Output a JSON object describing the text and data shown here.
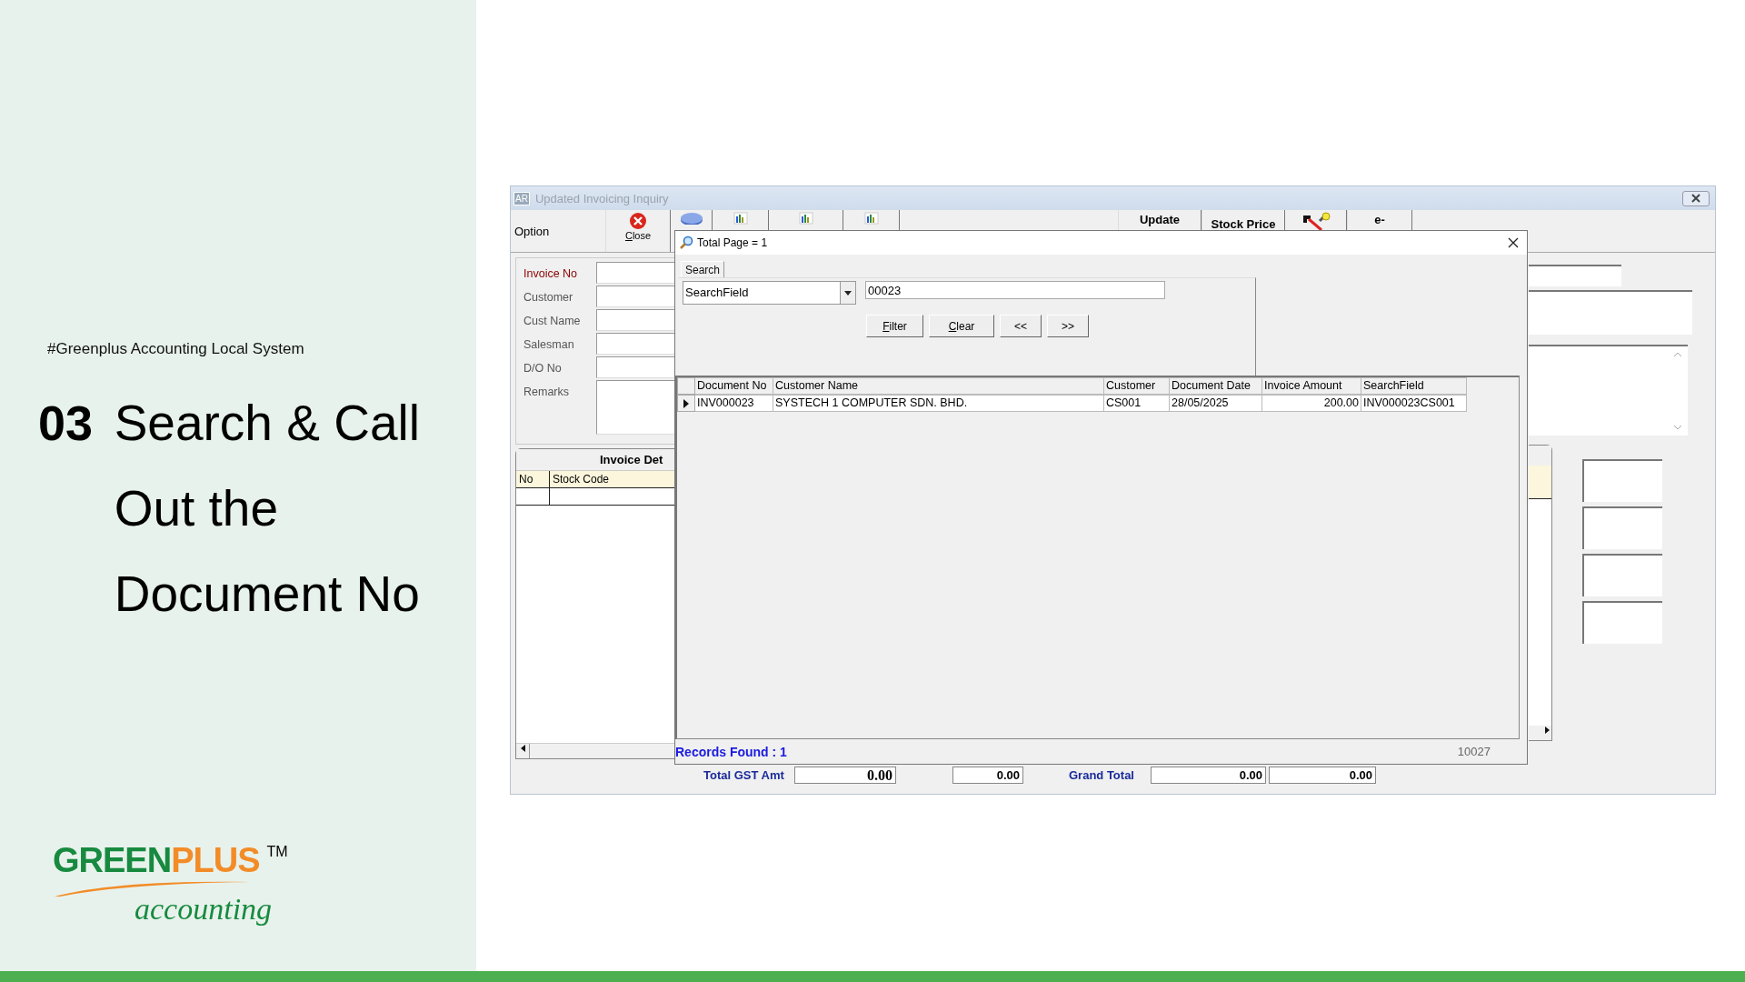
{
  "slide": {
    "hashtag": "#Greenplus Accounting Local System",
    "number": "03",
    "title": "Search & Call Out the Document No"
  },
  "logo": {
    "parts": [
      {
        "text": "GREEN",
        "color": "#178a3f"
      },
      {
        "text": "PLUS",
        "color": "#f28c28"
      }
    ],
    "trademark": "TM",
    "tagline": "accounting"
  },
  "window": {
    "badge": "AR",
    "title": "Updated Invoicing Inquiry"
  },
  "toolbar": {
    "option": "Option",
    "close": "Close",
    "update": "Update",
    "stock_price": "Stock Price",
    "e_label": "e-"
  },
  "form": {
    "fields": [
      {
        "label": "Invoice No",
        "required": true
      },
      {
        "label": "Customer",
        "required": false
      },
      {
        "label": "Cust Name",
        "required": false
      },
      {
        "label": "Salesman",
        "required": false
      },
      {
        "label": "D/O No",
        "required": false
      },
      {
        "label": "Remarks",
        "required": false
      }
    ]
  },
  "details": {
    "tab": "Invoice Det",
    "columns": [
      "No",
      "Stock Code"
    ]
  },
  "totals": {
    "gst_label": "Total GST Amt",
    "gst_amount": "0.00",
    "amount_2": "0.00",
    "grand_label": "Grand Total",
    "grand_1": "0.00",
    "grand_2": "0.00"
  },
  "dialog": {
    "title": "Total Page = 1",
    "tabs": [
      {
        "label": "Search",
        "selected": true
      }
    ],
    "search_by": "SearchField",
    "search_value": "00023",
    "buttons": [
      {
        "label": "Filter",
        "mnemonic": true
      },
      {
        "label": "Clear",
        "mnemonic": true
      },
      {
        "label": "<<",
        "mnemonic": false
      },
      {
        "label": ">>",
        "mnemonic": false
      }
    ],
    "grid": {
      "columns": [
        {
          "label": "Document No",
          "right_aligned": false
        },
        {
          "label": "Customer Name",
          "right_aligned": false
        },
        {
          "label": "Customer",
          "right_aligned": false
        },
        {
          "label": "Document Date",
          "right_aligned": false
        },
        {
          "label": "Invoice Amount",
          "right_aligned": true
        },
        {
          "label": "SearchField",
          "right_aligned": false
        }
      ],
      "rows": [
        {
          "selected": true,
          "cells": [
            "INV000023",
            "SYSTECH 1 COMPUTER SDN. BHD.",
            "CS001",
            "28/05/2025",
            "200.00",
            "INV000023CS001"
          ]
        }
      ]
    },
    "status": "Records Found : 1",
    "code": "10027"
  }
}
